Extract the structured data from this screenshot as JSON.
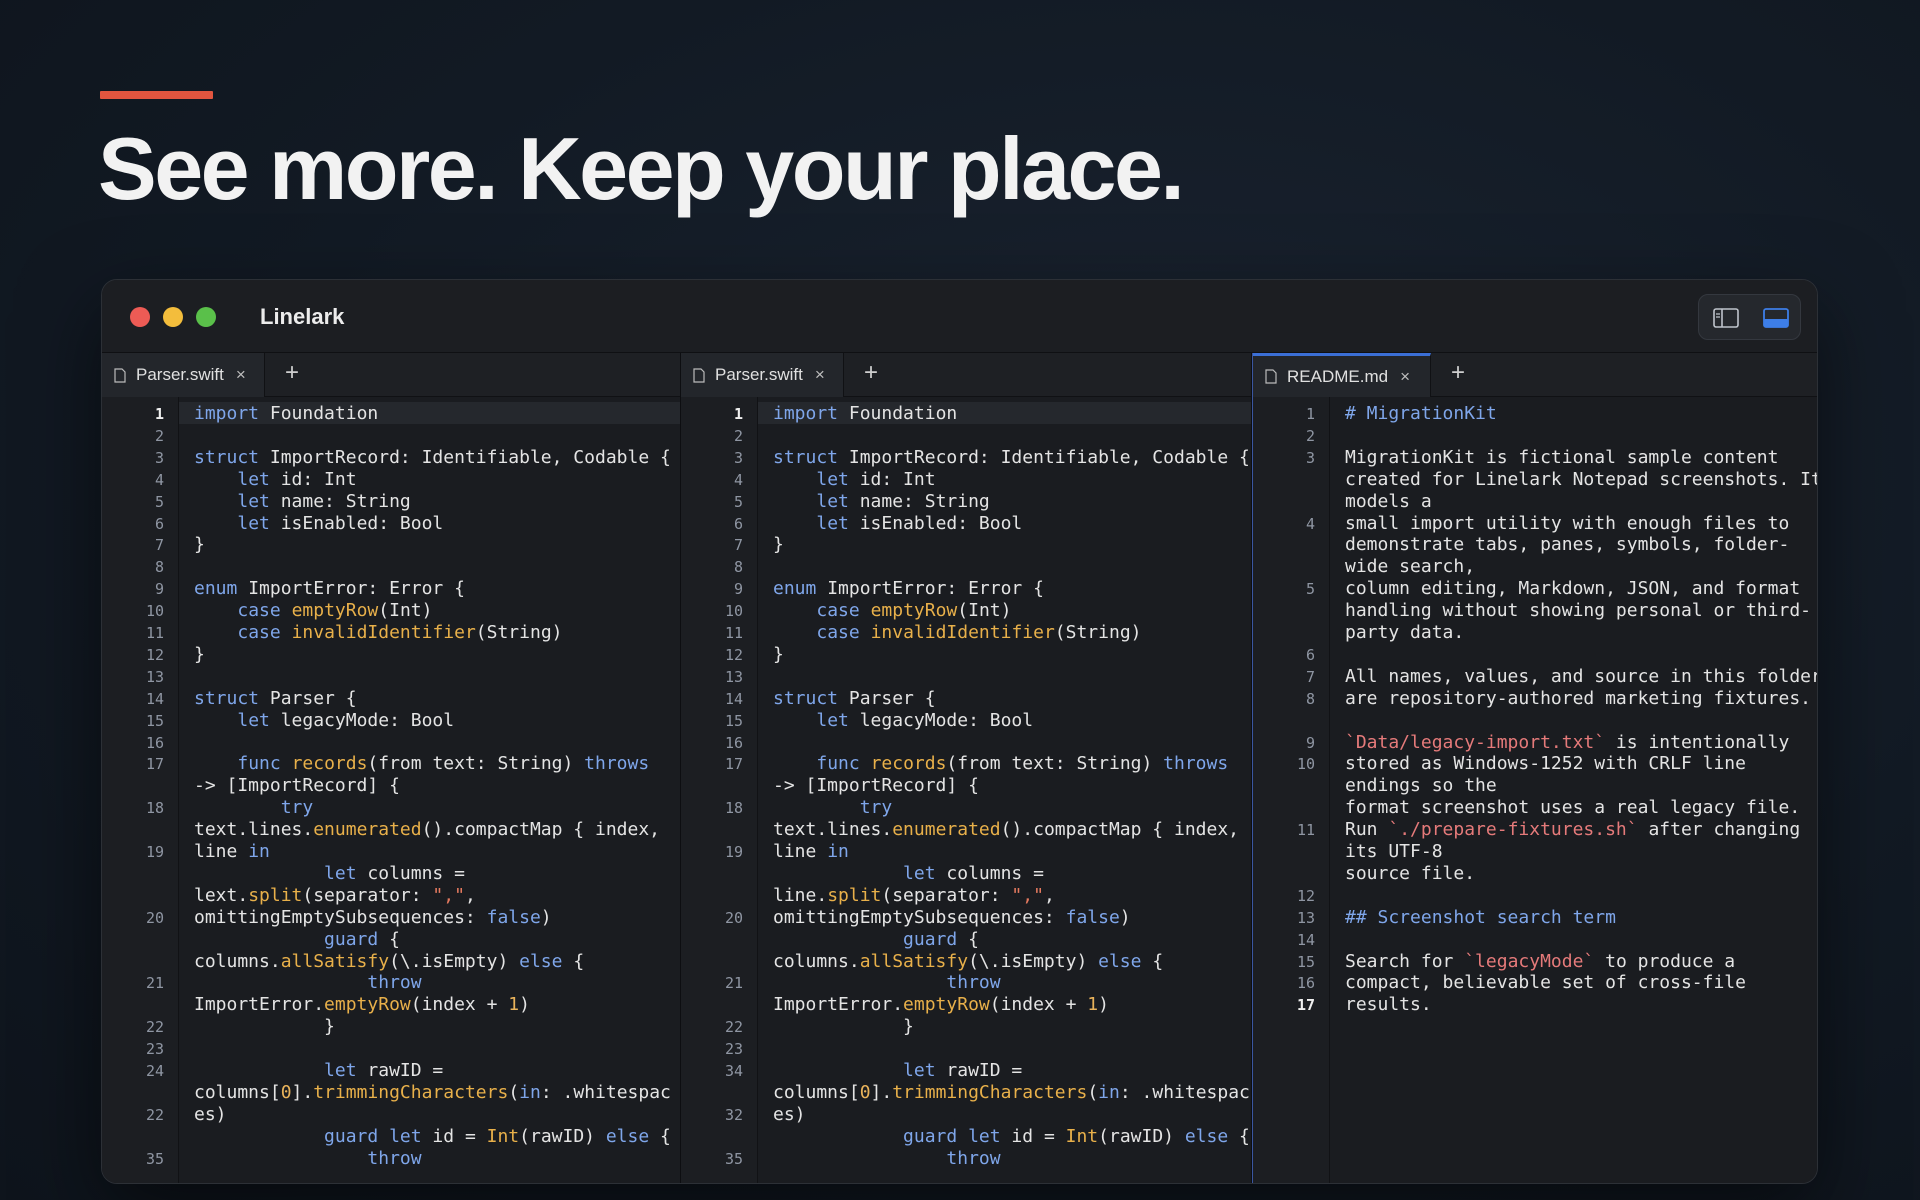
{
  "hero": {
    "headline": "See more. Keep your place."
  },
  "window": {
    "title": "Linelark",
    "toggle": {
      "left_icon": "sidebar-layout-icon",
      "right_icon": "bottom-panel-layout-icon"
    }
  },
  "colors": {
    "accent": "#e2553f",
    "keyword": "#7fa6ea",
    "function": "#e8b04a",
    "string": "#e57a5f",
    "active_tab": "#3b6fd6"
  },
  "panes": [
    {
      "tab": {
        "label": "Parser.swift",
        "close": "×"
      },
      "add": "+",
      "line_numbers": [
        "1",
        "2",
        "3",
        "4",
        "5",
        "6",
        "7",
        "8",
        "9",
        "10",
        "11",
        "12",
        "13",
        "14",
        "15",
        "16",
        "17",
        "18",
        "19",
        "20",
        "21",
        "22",
        "23",
        "24",
        "22",
        "35"
      ],
      "lines": [
        [
          {
            "t": "import",
            "c": "kw"
          },
          {
            "t": " Foundation"
          }
        ],
        [],
        [
          {
            "t": "struct",
            "c": "kw"
          },
          {
            "t": " ImportRecord: Identifiable, Codable {"
          }
        ],
        [
          {
            "t": "    "
          },
          {
            "t": "let",
            "c": "kw"
          },
          {
            "t": " id: Int"
          }
        ],
        [
          {
            "t": "    "
          },
          {
            "t": "let",
            "c": "kw"
          },
          {
            "t": " name: String"
          }
        ],
        [
          {
            "t": "    "
          },
          {
            "t": "let",
            "c": "kw"
          },
          {
            "t": " isEnabled: Bool"
          }
        ],
        [
          {
            "t": "}"
          }
        ],
        [],
        [
          {
            "t": "enum",
            "c": "kw"
          },
          {
            "t": " ImportError: Error {"
          }
        ],
        [
          {
            "t": "    "
          },
          {
            "t": "case",
            "c": "kw"
          },
          {
            "t": " "
          },
          {
            "t": "emptyRow",
            "c": "fn"
          },
          {
            "t": "(Int)"
          }
        ],
        [
          {
            "t": "    "
          },
          {
            "t": "case",
            "c": "kw"
          },
          {
            "t": " "
          },
          {
            "t": "invalidIdentifier",
            "c": "fn"
          },
          {
            "t": "(String)"
          }
        ],
        [
          {
            "t": "}"
          }
        ],
        [],
        [
          {
            "t": "struct",
            "c": "kw"
          },
          {
            "t": " Parser {"
          }
        ],
        [
          {
            "t": "    "
          },
          {
            "t": "let",
            "c": "kw"
          },
          {
            "t": " legacyMode: Bool"
          }
        ],
        [],
        [
          {
            "t": "    "
          },
          {
            "t": "func",
            "c": "kw"
          },
          {
            "t": " "
          },
          {
            "t": "records",
            "c": "fn"
          },
          {
            "t": "(from text: String) "
          },
          {
            "t": "throws",
            "c": "kw"
          }
        ],
        [
          {
            "t": "-> [ImportRecord] {"
          }
        ],
        [
          {
            "t": "        "
          },
          {
            "t": "try",
            "c": "kw"
          }
        ],
        [
          {
            "t": "text.lines."
          },
          {
            "t": "enumerated",
            "c": "fn"
          },
          {
            "t": "().compactMap { index,"
          }
        ],
        [
          {
            "t": "line "
          },
          {
            "t": "in",
            "c": "kw"
          }
        ],
        [
          {
            "t": "            "
          },
          {
            "t": "let",
            "c": "kw"
          },
          {
            "t": " columns ="
          }
        ],
        [
          {
            "t": "lext."
          },
          {
            "t": "split",
            "c": "fn"
          },
          {
            "t": "(separator: "
          },
          {
            "t": "\",\"",
            "c": "str"
          },
          {
            "t": ","
          }
        ],
        [
          {
            "t": "omittingEmptySubsequences: "
          },
          {
            "t": "false",
            "c": "kw"
          },
          {
            "t": ")"
          }
        ],
        [
          {
            "t": "            "
          },
          {
            "t": "guard",
            "c": "kw"
          },
          {
            "t": " {"
          }
        ],
        [
          {
            "t": "columns."
          },
          {
            "t": "allSatisfy",
            "c": "fn"
          },
          {
            "t": "(\\.isEmpty) "
          },
          {
            "t": "else",
            "c": "kw"
          },
          {
            "t": " {"
          }
        ],
        [
          {
            "t": "                "
          },
          {
            "t": "throw",
            "c": "kw"
          }
        ],
        [
          {
            "t": "ImportError."
          },
          {
            "t": "emptyRow",
            "c": "fn"
          },
          {
            "t": "(index + "
          },
          {
            "t": "1",
            "c": "num"
          },
          {
            "t": ")"
          }
        ],
        [
          {
            "t": "            }"
          }
        ],
        [],
        [
          {
            "t": "            "
          },
          {
            "t": "let",
            "c": "kw"
          },
          {
            "t": " rawID ="
          }
        ],
        [
          {
            "t": "columns["
          },
          {
            "t": "0",
            "c": "num"
          },
          {
            "t": "]."
          },
          {
            "t": "trimmingCharacters",
            "c": "fn"
          },
          {
            "t": "("
          },
          {
            "t": "in",
            "c": "kw"
          },
          {
            "t": ": .whitespac"
          }
        ],
        [
          {
            "t": "es)"
          }
        ],
        [
          {
            "t": "            "
          },
          {
            "t": "guard",
            "c": "kw"
          },
          {
            "t": " "
          },
          {
            "t": "let",
            "c": "kw"
          },
          {
            "t": " id = "
          },
          {
            "t": "Int",
            "c": "fn"
          },
          {
            "t": "(rawID) "
          },
          {
            "t": "else",
            "c": "kw"
          },
          {
            "t": " {"
          }
        ],
        [
          {
            "t": "                "
          },
          {
            "t": "throw",
            "c": "kw"
          }
        ]
      ]
    },
    {
      "tab": {
        "label": "Parser.swift",
        "close": "×"
      },
      "add": "+",
      "line_numbers": [
        "1",
        "2",
        "3",
        "4",
        "5",
        "6",
        "7",
        "8",
        "9",
        "10",
        "11",
        "12",
        "13",
        "14",
        "15",
        "16",
        "17",
        "18",
        "19",
        "20",
        "21",
        "22",
        "23",
        "34",
        "32",
        "35"
      ],
      "lines": [
        [
          {
            "t": "import",
            "c": "kw"
          },
          {
            "t": " Foundation"
          }
        ],
        [],
        [
          {
            "t": "struct",
            "c": "kw"
          },
          {
            "t": " ImportRecord: Identifiable, Codable {"
          }
        ],
        [
          {
            "t": "    "
          },
          {
            "t": "let",
            "c": "kw"
          },
          {
            "t": " id: Int"
          }
        ],
        [
          {
            "t": "    "
          },
          {
            "t": "let",
            "c": "kw"
          },
          {
            "t": " name: String"
          }
        ],
        [
          {
            "t": "    "
          },
          {
            "t": "let",
            "c": "kw"
          },
          {
            "t": " isEnabled: Bool"
          }
        ],
        [
          {
            "t": "}"
          }
        ],
        [],
        [
          {
            "t": "enum",
            "c": "kw"
          },
          {
            "t": " ImportError: Error {"
          }
        ],
        [
          {
            "t": "    "
          },
          {
            "t": "case",
            "c": "kw"
          },
          {
            "t": " "
          },
          {
            "t": "emptyRow",
            "c": "fn"
          },
          {
            "t": "(Int)"
          }
        ],
        [
          {
            "t": "    "
          },
          {
            "t": "case",
            "c": "kw"
          },
          {
            "t": " "
          },
          {
            "t": "invalidIdentifier",
            "c": "fn"
          },
          {
            "t": "(String)"
          }
        ],
        [
          {
            "t": "}"
          }
        ],
        [],
        [
          {
            "t": "struct",
            "c": "kw"
          },
          {
            "t": " Parser {"
          }
        ],
        [
          {
            "t": "    "
          },
          {
            "t": "let",
            "c": "kw"
          },
          {
            "t": " legacyMode: Bool"
          }
        ],
        [],
        [
          {
            "t": "    "
          },
          {
            "t": "func",
            "c": "kw"
          },
          {
            "t": " "
          },
          {
            "t": "records",
            "c": "fn"
          },
          {
            "t": "(from text: String) "
          },
          {
            "t": "throws",
            "c": "kw"
          }
        ],
        [
          {
            "t": "-> [ImportRecord] {"
          }
        ],
        [
          {
            "t": "        "
          },
          {
            "t": "try",
            "c": "kw"
          }
        ],
        [
          {
            "t": "text.lines."
          },
          {
            "t": "enumerated",
            "c": "fn"
          },
          {
            "t": "().compactMap { index,"
          }
        ],
        [
          {
            "t": "line "
          },
          {
            "t": "in",
            "c": "kw"
          }
        ],
        [
          {
            "t": "            "
          },
          {
            "t": "let",
            "c": "kw"
          },
          {
            "t": " columns ="
          }
        ],
        [
          {
            "t": "line."
          },
          {
            "t": "split",
            "c": "fn"
          },
          {
            "t": "(separator: "
          },
          {
            "t": "\",\"",
            "c": "str"
          },
          {
            "t": ","
          }
        ],
        [
          {
            "t": "omittingEmptySubsequences: "
          },
          {
            "t": "false",
            "c": "kw"
          },
          {
            "t": ")"
          }
        ],
        [
          {
            "t": "            "
          },
          {
            "t": "guard",
            "c": "kw"
          },
          {
            "t": " {"
          }
        ],
        [
          {
            "t": "columns."
          },
          {
            "t": "allSatisfy",
            "c": "fn"
          },
          {
            "t": "(\\.isEmpty) "
          },
          {
            "t": "else",
            "c": "kw"
          },
          {
            "t": " {"
          }
        ],
        [
          {
            "t": "                "
          },
          {
            "t": "throw",
            "c": "kw"
          }
        ],
        [
          {
            "t": "ImportError."
          },
          {
            "t": "emptyRow",
            "c": "fn"
          },
          {
            "t": "(index + "
          },
          {
            "t": "1",
            "c": "num"
          },
          {
            "t": ")"
          }
        ],
        [
          {
            "t": "            }"
          }
        ],
        [],
        [
          {
            "t": "            "
          },
          {
            "t": "let",
            "c": "kw"
          },
          {
            "t": " rawID ="
          }
        ],
        [
          {
            "t": "columns["
          },
          {
            "t": "0",
            "c": "num"
          },
          {
            "t": "]."
          },
          {
            "t": "trimmingCharacters",
            "c": "fn"
          },
          {
            "t": "("
          },
          {
            "t": "in",
            "c": "kw"
          },
          {
            "t": ": .whitespac"
          }
        ],
        [
          {
            "t": "es)"
          }
        ],
        [
          {
            "t": "            "
          },
          {
            "t": "guard",
            "c": "kw"
          },
          {
            "t": " "
          },
          {
            "t": "let",
            "c": "kw"
          },
          {
            "t": " id = "
          },
          {
            "t": "Int",
            "c": "fn"
          },
          {
            "t": "(rawID) "
          },
          {
            "t": "else",
            "c": "kw"
          },
          {
            "t": " {"
          }
        ],
        [
          {
            "t": "                "
          },
          {
            "t": "throw",
            "c": "kw"
          }
        ]
      ]
    },
    {
      "tab": {
        "label": "README.md",
        "close": "×"
      },
      "add": "+",
      "line_numbers": [
        "1",
        "2",
        "3",
        "4",
        "5",
        "6",
        "7",
        "8",
        "9",
        "10",
        "11",
        "12",
        "13",
        "14",
        "15",
        "16",
        "17"
      ],
      "lines": [
        [
          {
            "t": "# MigrationKit",
            "c": "md-h"
          }
        ],
        [],
        [
          {
            "t": "MigrationKit is fictional sample content"
          }
        ],
        [
          {
            "t": "created for Linelark Notepad screenshots. It"
          }
        ],
        [
          {
            "t": "models a"
          }
        ],
        [
          {
            "t": "small import utility with enough files to"
          }
        ],
        [
          {
            "t": "demonstrate tabs, panes, symbols, folder-"
          }
        ],
        [
          {
            "t": "wide search,"
          }
        ],
        [
          {
            "t": "column editing, Markdown, JSON, and format"
          }
        ],
        [
          {
            "t": "handling without showing personal or third-"
          }
        ],
        [
          {
            "t": "party data."
          }
        ],
        [],
        [
          {
            "t": "All names, values, and source in this folder"
          }
        ],
        [
          {
            "t": "are repository-authored marketing fixtures."
          }
        ],
        [],
        [
          {
            "t": "`Data/legacy-import.txt`",
            "c": "md-code"
          },
          {
            "t": " is intentionally"
          }
        ],
        [
          {
            "t": "stored as Windows-1252 with CRLF line"
          }
        ],
        [
          {
            "t": "endings so the"
          }
        ],
        [
          {
            "t": "format screenshot uses a real legacy file."
          }
        ],
        [
          {
            "t": "Run "
          },
          {
            "t": "`./prepare-fixtures.sh`",
            "c": "md-code"
          },
          {
            "t": " after changing"
          }
        ],
        [
          {
            "t": "its UTF-8"
          }
        ],
        [
          {
            "t": "source file."
          }
        ],
        [],
        [
          {
            "t": "## Screenshot search term",
            "c": "md-h"
          }
        ],
        [],
        [
          {
            "t": "Search for "
          },
          {
            "t": "`legacyMode`",
            "c": "md-code"
          },
          {
            "t": " to produce a"
          }
        ],
        [
          {
            "t": "compact, believable set of cross-file"
          }
        ],
        [
          {
            "t": "results."
          }
        ]
      ]
    }
  ]
}
